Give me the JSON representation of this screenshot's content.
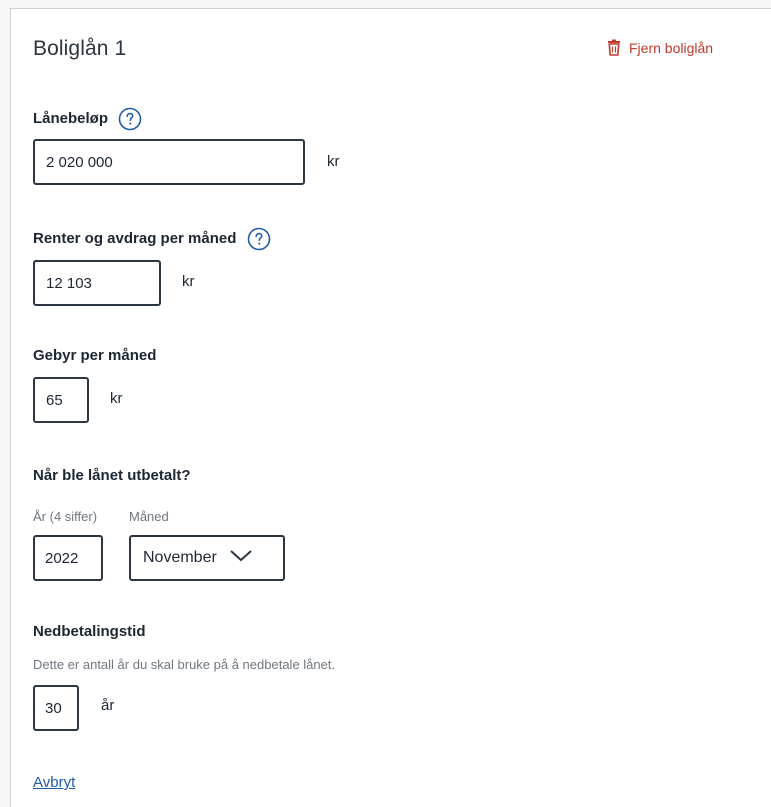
{
  "card": {
    "title": "Boliglån 1",
    "remove_label": "Fjern boliglån"
  },
  "loan_amount": {
    "label": "Lånebeløp",
    "value": "2 020 000",
    "unit": "kr"
  },
  "monthly_payment": {
    "label": "Renter og avdrag per måned",
    "value": "12 103",
    "unit": "kr"
  },
  "monthly_fee": {
    "label": "Gebyr per måned",
    "value": "65",
    "unit": "kr"
  },
  "payout_date": {
    "label": "Når ble lånet utbetalt?",
    "year_label": "År (4 siffer)",
    "month_label": "Måned",
    "year_value": "2022",
    "month_value": "November"
  },
  "repayment_period": {
    "label": "Nedbetalingstid",
    "description": "Dette er antall år du skal bruke på å nedbetale lånet.",
    "value": "30",
    "unit": "år"
  },
  "cancel_label": "Avbryt",
  "colors": {
    "danger": "#c0392b",
    "link": "#1f5ba8",
    "help_icon": "#1f5ba8",
    "field_border": "#2b3640"
  },
  "icons": {
    "remove": "trash-icon",
    "help": "question-circle-icon",
    "select": "chevron-down-icon"
  }
}
